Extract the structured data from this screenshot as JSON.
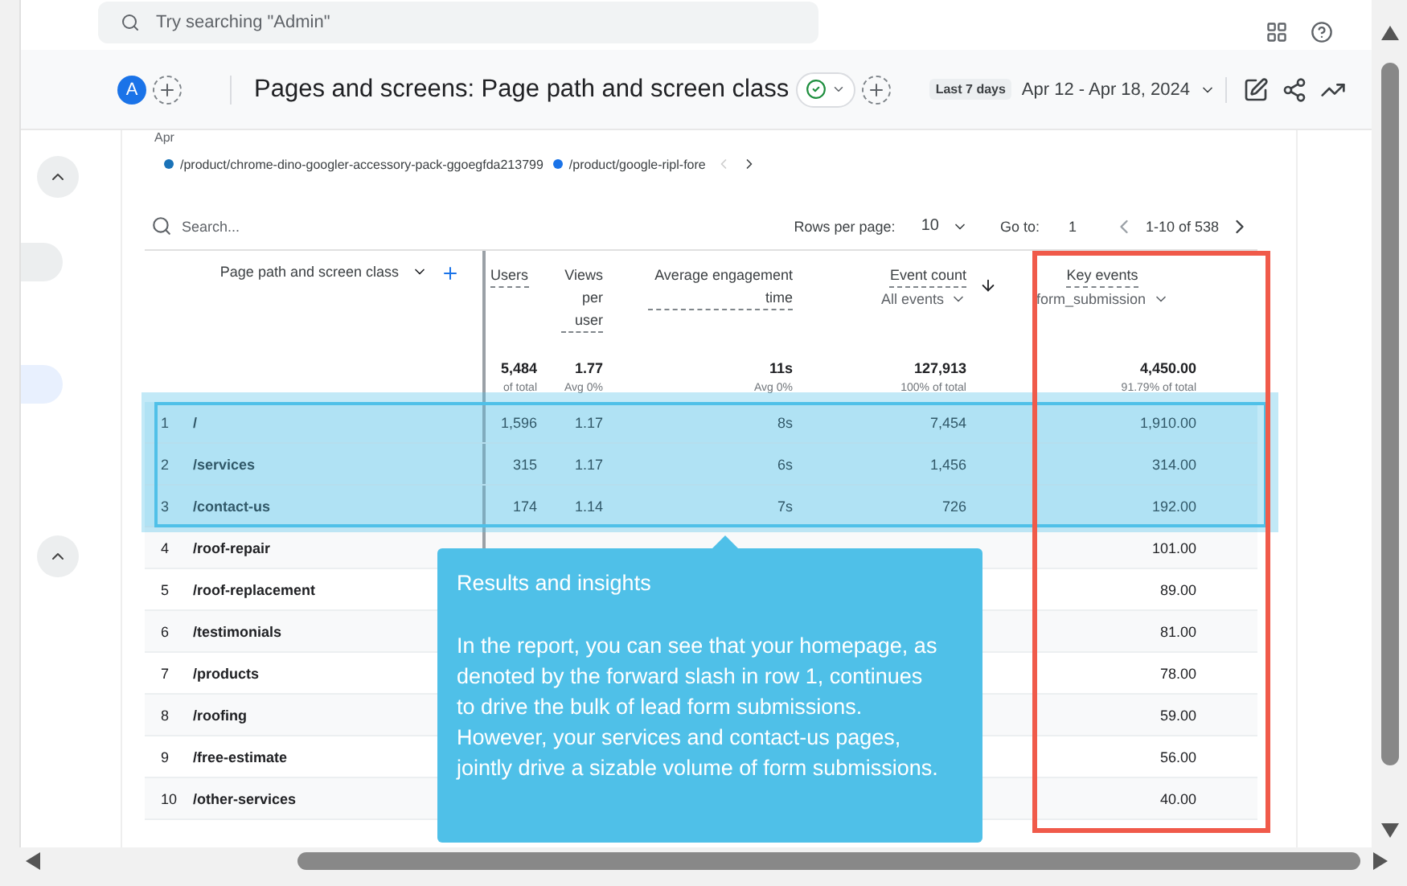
{
  "topbar": {
    "search_placeholder": "Try searching \"Admin\""
  },
  "header": {
    "avatar": "A",
    "title": "Pages and screens: Page path and screen class",
    "range_chip": "Last 7 days",
    "date_range": "Apr 12 - Apr 18, 2024"
  },
  "chart_legend": {
    "axis_label": "Apr",
    "items": [
      {
        "label": "/product/chrome-dino-googler-accessory-pack-ggoegfda213799",
        "color": "#1a73b8"
      },
      {
        "label": "/product/google-ripl-fore",
        "color": "#1a73e8"
      }
    ]
  },
  "table_toolbar": {
    "search_placeholder": "Search...",
    "rows_per_page_label": "Rows per page:",
    "rows_per_page": "10",
    "goto_label": "Go to:",
    "goto_value": "1",
    "page_info": "1-10 of 538"
  },
  "columns": [
    {
      "label": "Page path and screen class",
      "kind": "dimension"
    },
    {
      "label": "Users",
      "kind": "metric"
    },
    {
      "label": "Views per user",
      "kind": "metric"
    },
    {
      "label": "Average engagement time",
      "kind": "metric"
    },
    {
      "label": "Event count",
      "sub": "All events",
      "kind": "metric"
    },
    {
      "label": "Key events",
      "sub": "form_submission",
      "kind": "metric"
    }
  ],
  "totals": [
    {
      "value": "5,484",
      "note": "of total"
    },
    {
      "value": "1.77",
      "note": "Avg 0%"
    },
    {
      "value": "11s",
      "note": "Avg 0%"
    },
    {
      "value": "127,913",
      "note": "100% of total"
    },
    {
      "value": "4,450.00",
      "note": "91.79% of total"
    }
  ],
  "rows": [
    {
      "index": "1",
      "path": "/",
      "users": "1,596",
      "views": "1.17",
      "engagement": "8s",
      "events": "7,454",
      "key_events": "1,910.00",
      "highlighted": true
    },
    {
      "index": "2",
      "path": "/services",
      "users": "315",
      "views": "1.17",
      "engagement": "6s",
      "events": "1,456",
      "key_events": "314.00",
      "highlighted": true
    },
    {
      "index": "3",
      "path": "/contact-us",
      "users": "174",
      "views": "1.14",
      "engagement": "7s",
      "events": "726",
      "key_events": "192.00",
      "highlighted": true
    },
    {
      "index": "4",
      "path": "/roof-repair",
      "key_events": "101.00",
      "highlighted": false
    },
    {
      "index": "5",
      "path": "/roof-replacement",
      "key_events": "89.00",
      "highlighted": false
    },
    {
      "index": "6",
      "path": "/testimonials",
      "key_events": "81.00",
      "highlighted": false
    },
    {
      "index": "7",
      "path": "/products",
      "key_events": "78.00",
      "highlighted": false
    },
    {
      "index": "8",
      "path": "/roofing",
      "key_events": "59.00",
      "highlighted": false
    },
    {
      "index": "9",
      "path": "/free-estimate",
      "key_events": "56.00",
      "highlighted": false
    },
    {
      "index": "10",
      "path": "/other-services",
      "key_events": "40.00",
      "highlighted": false
    }
  ],
  "callout": {
    "title": "Results and insights",
    "body": "In the report, you can see that your homepage, as denoted by the forward slash in row 1, continues to drive the bulk of lead form submissions. However, your services and contact-us pages, jointly drive a sizable volume of form submissions."
  }
}
